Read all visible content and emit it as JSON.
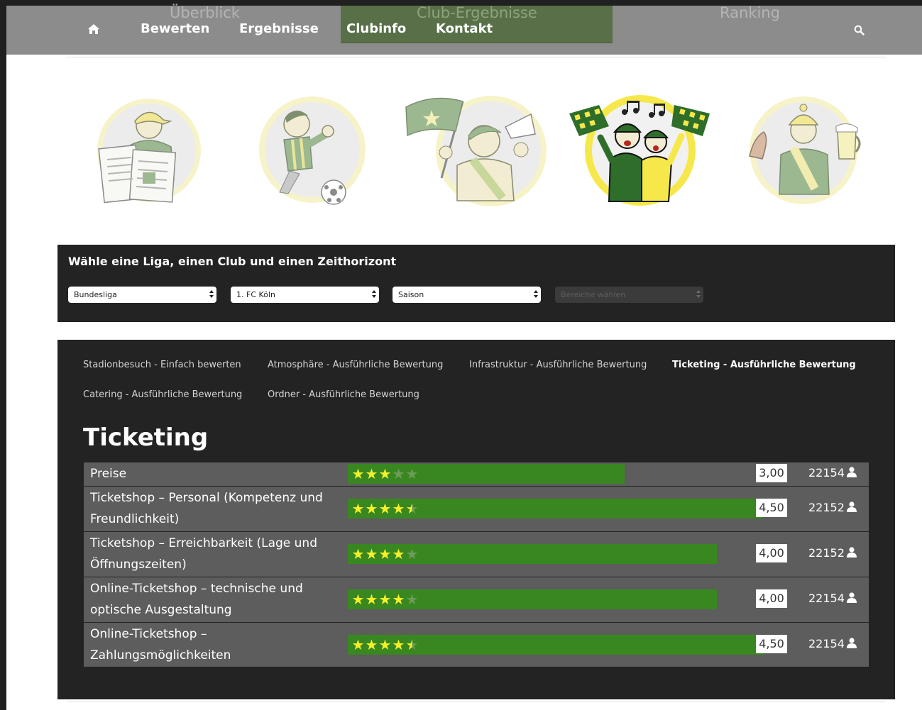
{
  "colors": {
    "nav_bg": "#8c8c8c",
    "nav_highlight": "#586f48",
    "panel_bg": "#222322",
    "row_bg": "#5c5d5c",
    "bar_green": "#398720",
    "star_yellow": "#f4f12a",
    "mascot_yellow": "#f6e84a",
    "mascot_green": "#2e6e2a"
  },
  "nav": {
    "home_icon": "home-icon",
    "ghost_items": [
      "Überblick",
      "Club-Ergebnisse",
      "Ranking"
    ],
    "items": [
      {
        "label": "Bewerten"
      },
      {
        "label": "Ergebnisse"
      },
      {
        "label": "Clubinfo"
      },
      {
        "label": "Kontakt"
      }
    ],
    "search_icon": "search-icon"
  },
  "mascots": [
    {
      "name": "newspaper-reader",
      "active": false
    },
    {
      "name": "soccer-player",
      "active": false
    },
    {
      "name": "flag-fan",
      "active": false
    },
    {
      "name": "singing-fans",
      "active": true
    },
    {
      "name": "food-and-beer-fan",
      "active": false
    }
  ],
  "selector": {
    "heading": "Wähle eine Liga, einen Club und einen Zeithorizont",
    "selects": [
      {
        "value": "Bundesliga",
        "disabled": false
      },
      {
        "value": "1. FC Köln",
        "disabled": false
      },
      {
        "value": "Saison",
        "disabled": false
      },
      {
        "value": "Bereiche wählen",
        "disabled": true
      }
    ]
  },
  "results": {
    "tabs": [
      {
        "label": "Stadionbesuch - Einfach bewerten",
        "active": false
      },
      {
        "label": "Atmosphäre - Ausführliche Bewertung",
        "active": false
      },
      {
        "label": "Infrastruktur - Ausführliche Bewertung",
        "active": false
      },
      {
        "label": "Ticketing - Ausführliche Bewertung",
        "active": true
      },
      {
        "label": "Catering - Ausführliche Bewertung",
        "active": false
      },
      {
        "label": "Ordner - Ausführliche Bewertung",
        "active": false
      }
    ],
    "title": "Ticketing",
    "rows": [
      {
        "label": "Preise",
        "rating": 3.0,
        "score": "3,00",
        "count": "22154"
      },
      {
        "label": "Ticketshop – Personal (Kompetenz und Freundlichkeit)",
        "rating": 4.5,
        "score": "4,50",
        "count": "22152"
      },
      {
        "label": "Ticketshop – Erreichbarkeit (Lage und Öffnungszeiten)",
        "rating": 4.0,
        "score": "4,00",
        "count": "22152"
      },
      {
        "label": "Online-Ticketshop – technische und optische Ausgestaltung",
        "rating": 4.0,
        "score": "4,00",
        "count": "22154"
      },
      {
        "label": "Online-Ticketshop – Zahlungsmöglichkeiten",
        "rating": 4.5,
        "score": "4,50",
        "count": "22154"
      }
    ],
    "user_icon": "user-icon"
  }
}
